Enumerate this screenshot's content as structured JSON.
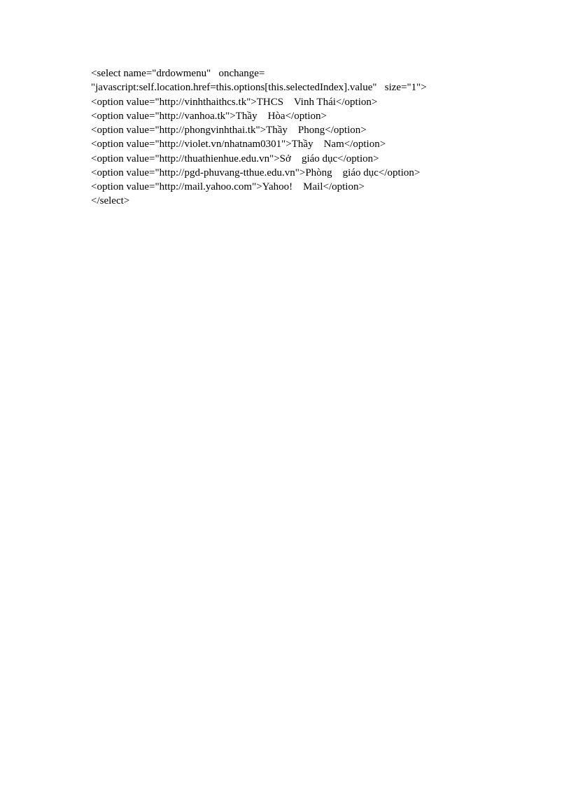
{
  "lines": [
    "<select name=\"drdowmenu\"   onchange=",
    "\"javascript:self.location.href=this.options[this.selectedIndex].value\"   size=\"1\">",
    "<option value=\"http://vinhthaithcs.tk\">THCS    Vinh Thái</option>",
    "<option value=\"http://vanhoa.tk\">Thầy    Hòa</option>",
    "<option value=\"http://phongvinhthai.tk\">Thầy    Phong</option>",
    "<option value=\"http://violet.vn/nhatnam0301\">Thầy    Nam</option>",
    "<option value=\"http://thuathienhue.edu.vn\">Sở    giáo dục</option>",
    "<option value=\"http://pgd-phuvang-tthue.edu.vn\">Phòng    giáo dục</option>",
    "<option value=\"http://mail.yahoo.com\">Yahoo!    Mail</option>",
    "</select>"
  ]
}
